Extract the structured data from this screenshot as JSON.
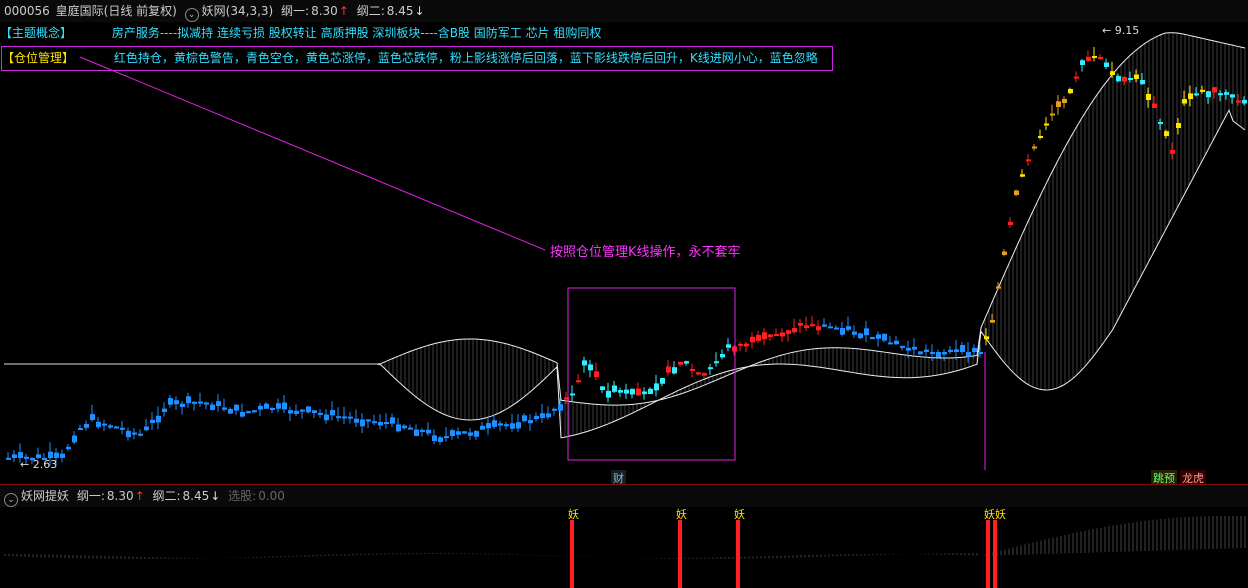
{
  "header": {
    "stock_code": "000056",
    "stock_name": "皇庭国际",
    "period": "(日线 前复权)",
    "indicator": "妖网(34,3,3)",
    "gang1_label": "纲一:",
    "gang1_value": "8.30",
    "gang2_label": "纲二:",
    "gang2_value": "8.45"
  },
  "concepts": {
    "label": "【主题概念】",
    "text": "房产服务----拟减持 连续亏损 股权转让 高质押股 深圳板块----含B股 国防军工 芯片 租购同权"
  },
  "position_mgmt": {
    "label": "【仓位管理】",
    "text": "红色持仓，黄棕色警告，青色空仓，黄色芯涨停，蓝色芯跌停，粉上影线涨停后回落，蓝下影线跌停后回升，K线进网小心，蓝色忽略"
  },
  "annotation": "按照仓位管理K线操作，永不套牢",
  "price_labels": {
    "low": "2.63",
    "high": "9.15"
  },
  "tags": {
    "finance": "财",
    "jl": "跳预",
    "lh": "龙虎"
  },
  "sub_header": {
    "indicator": "妖网提妖",
    "gang1_label": "纲一:",
    "gang1_value": "8.30",
    "gang2_label": "纲二:",
    "gang2_value": "8.45",
    "xuan_label": "选股:",
    "xuan_value": "0.00"
  },
  "yao_markers": [
    "妖",
    "妖",
    "妖",
    "妖妖"
  ],
  "colors": {
    "red": "#ff2020",
    "cyan": "#33eeff",
    "blue": "#1e90ff",
    "yellow": "#ffe600",
    "magenta": "#e020e0"
  }
}
